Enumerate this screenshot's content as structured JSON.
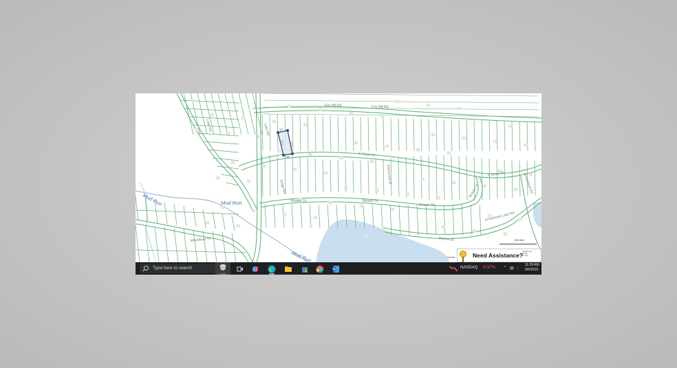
{
  "map": {
    "road_labels": [
      "Fox Hill Rd",
      "Fox Hill Rd",
      "E Shore Dr",
      "E Shore Dr",
      "Beaver Dr",
      "Beaver Dr",
      "Beaver Dr",
      "Beaver Dr",
      "Skyline Dr",
      "Woodland Trl",
      "Lake Rd",
      "Lake Rd",
      "Ridge Rd",
      "Arrowhead Lake Rd",
      "Glenwood Dr",
      "Arrowhead Rd"
    ],
    "water_labels": [
      "Mud Run",
      "Mud Run",
      "Mud Run"
    ],
    "dimension_labels": [
      "97",
      "215",
      "98",
      "215"
    ],
    "scale_label": "250 feet",
    "info_label": "Inform",
    "colors": {
      "parcel_lines": "#5aad73",
      "water": "#c9dff0",
      "stream": "#9fbcd8",
      "selection": "#33477a",
      "background": "#ffffff"
    }
  },
  "assist": {
    "label": "Need Assistance?",
    "brand_lines": [
      "Lighthouse",
      "Realty",
      "Group"
    ]
  },
  "taskbar": {
    "search_placeholder": "Type here to search",
    "ticker": "NASDAQ",
    "ticker_change": "-0.57%",
    "time": "11:39 AM",
    "date": "5/6/2025",
    "icons": [
      "windows-start-icon",
      "search-icon",
      "task-view-icon",
      "copilot-icon",
      "edge-icon",
      "file-explorer-icon",
      "store-icon",
      "chrome-icon",
      "word-icon",
      "stock-chart-icon",
      "chevron-up-icon",
      "network-icon",
      "speaker-icon"
    ]
  }
}
